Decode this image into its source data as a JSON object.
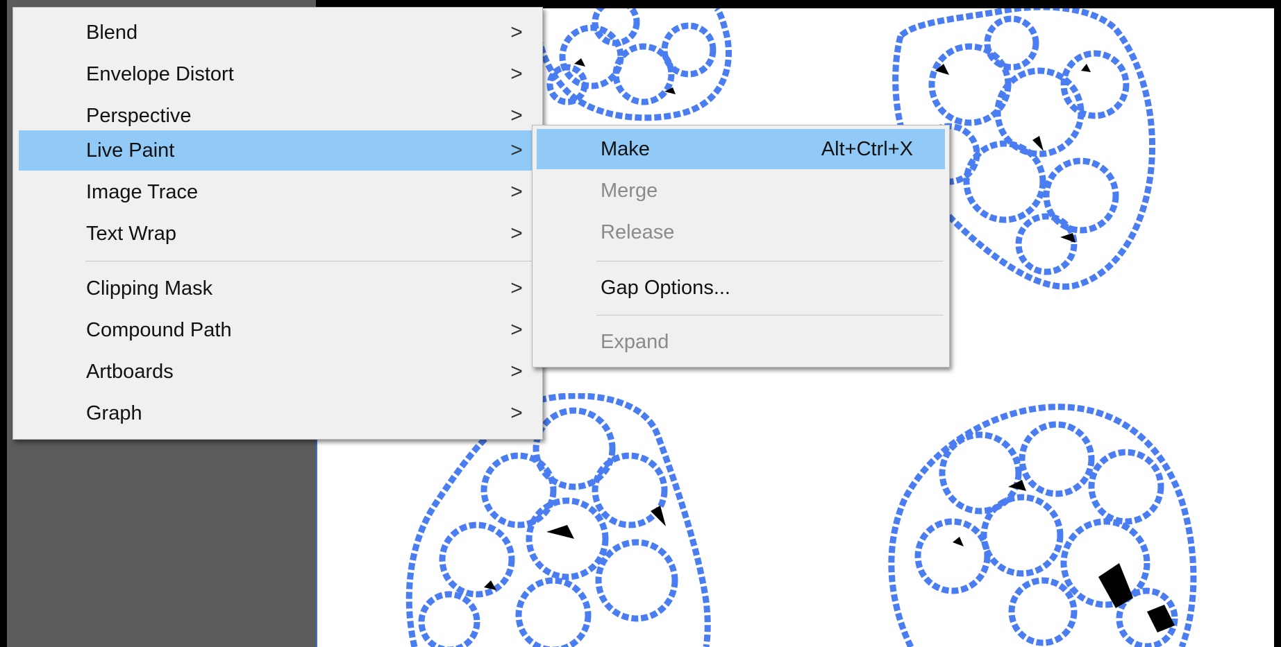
{
  "colors": {
    "menu_bg": "#f0f0f0",
    "highlight": "#91c9f7",
    "disabled": "#8a8a8a",
    "path_blue": "#4a7df2",
    "pasteboard": "#5b5b5b"
  },
  "menu": {
    "items": [
      {
        "label": "Blend",
        "chevron": ">"
      },
      {
        "label": "Envelope Distort",
        "chevron": ">"
      },
      {
        "label": "Perspective",
        "chevron": ">"
      },
      {
        "label": "Live Paint",
        "chevron": ">",
        "active": true
      },
      {
        "label": "Image Trace",
        "chevron": ">"
      },
      {
        "label": "Text Wrap",
        "chevron": ">"
      },
      {
        "label": "Clipping Mask",
        "chevron": ">"
      },
      {
        "label": "Compound Path",
        "chevron": ">"
      },
      {
        "label": "Artboards",
        "chevron": ">"
      },
      {
        "label": "Graph",
        "chevron": ">"
      }
    ]
  },
  "submenu": {
    "items": [
      {
        "label": "Make",
        "shortcut": "Alt+Ctrl+X",
        "enabled": true,
        "active": true
      },
      {
        "label": "Merge",
        "enabled": false
      },
      {
        "label": "Release",
        "enabled": false
      },
      {
        "label": "Gap Options...",
        "enabled": true
      },
      {
        "label": "Expand",
        "enabled": false
      }
    ]
  },
  "canvas": {
    "objects": [
      "traced-blob",
      "traced-blob",
      "traced-blob",
      "traced-blob"
    ]
  }
}
